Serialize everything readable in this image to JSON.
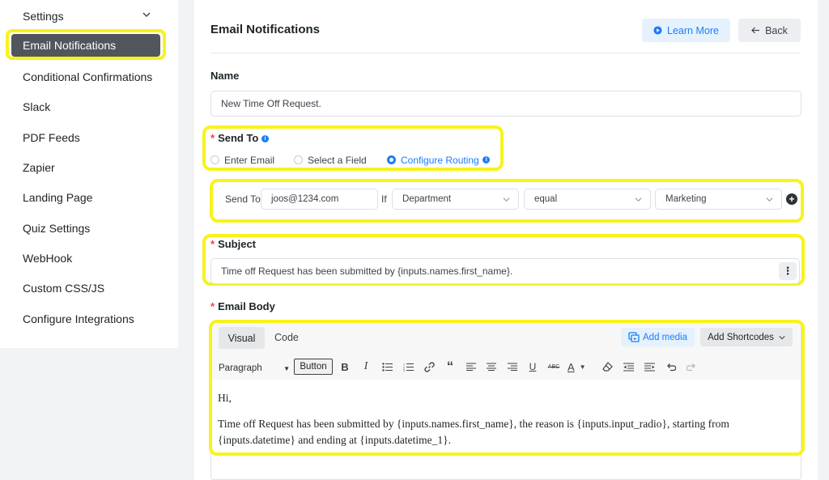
{
  "sidebar": {
    "settings_label": "Settings",
    "items": [
      {
        "label": "Email Notifications"
      },
      {
        "label": "Conditional Confirmations"
      },
      {
        "label": "Slack"
      },
      {
        "label": "PDF Feeds"
      },
      {
        "label": "Zapier"
      },
      {
        "label": "Landing Page"
      },
      {
        "label": "Quiz Settings"
      },
      {
        "label": "WebHook"
      },
      {
        "label": "Custom CSS/JS"
      },
      {
        "label": "Configure Integrations"
      }
    ]
  },
  "header": {
    "title": "Email Notifications",
    "learn_more_label": "Learn More",
    "back_label": "Back"
  },
  "form": {
    "name_label": "Name",
    "name_value": "New Time Off Request.",
    "send_to_label": "Send To",
    "send_to_options": [
      {
        "label": "Enter Email",
        "selected": false
      },
      {
        "label": "Select a Field",
        "selected": false
      },
      {
        "label": "Configure Routing",
        "selected": true
      }
    ],
    "routing": {
      "send_to_label": "Send To",
      "email_value": "joos@1234.com",
      "if_label": "If",
      "field_value": "Department",
      "operator_value": "equal",
      "match_value": "Marketing"
    },
    "subject_label": "Subject",
    "subject_value": "Time off Request has been submitted by {inputs.names.first_name}.",
    "email_body_label": "Email Body"
  },
  "editor": {
    "tabs": [
      {
        "label": "Visual"
      },
      {
        "label": "Code"
      }
    ],
    "add_media_label": "Add media",
    "add_shortcodes_label": "Add Shortcodes",
    "format_select_value": "Paragraph",
    "button_label": "Button",
    "body_line1": "Hi,",
    "body_line2": "Time off Request has been submitted by {inputs.names.first_name}, the reason is {inputs.input_radio}, starting from",
    "body_line3": "{inputs.datetime} and ending at {inputs.datetime_1}."
  },
  "colors": {
    "accent": "#1a7efb",
    "highlight": "#f7f31b",
    "active_sidebar": "#50565c",
    "required": "#ef4444"
  },
  "icons": {
    "learn_more": "play-circle-icon",
    "back": "arrow-left-icon",
    "add_routing": "plus-circle-icon",
    "subject_menu": "kebab-menu-icon"
  }
}
